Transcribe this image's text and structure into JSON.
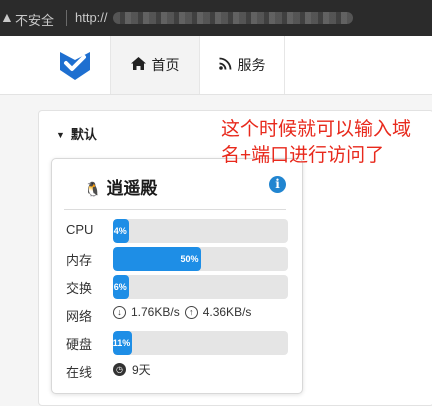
{
  "browser": {
    "security_label": "不安全",
    "url_prefix": "http://"
  },
  "nav": {
    "tabs": [
      {
        "label": "首页",
        "icon": "home-icon"
      },
      {
        "label": "服务",
        "icon": "rss-icon"
      }
    ]
  },
  "group": {
    "title": "默认"
  },
  "server": {
    "name": "逍遥殿",
    "os_icon": "linux-penguin-icon",
    "cpu": {
      "label": "CPU",
      "percent": 4,
      "text": "4%"
    },
    "mem": {
      "label": "内存",
      "percent": 50,
      "text": "50%"
    },
    "swap": {
      "label": "交换",
      "percent": 6,
      "text": "6%"
    },
    "net": {
      "label": "网络",
      "down": "1.76KB/s",
      "up": "4.36KB/s"
    },
    "disk": {
      "label": "硬盘",
      "percent": 11,
      "text": "11%"
    },
    "uptime": {
      "label": "在线",
      "value": "9天"
    }
  },
  "annotation": "这个时候就可以输入域名+端口进行访问了",
  "colors": {
    "accent": "#1e8ee6",
    "annotation": "#e8291c"
  }
}
